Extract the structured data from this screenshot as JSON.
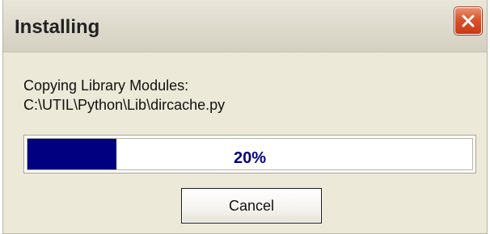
{
  "window": {
    "title": "Installing",
    "close_icon": "close-icon"
  },
  "status": {
    "line1": "Copying Library Modules:",
    "line2": "C:\\UTIL\\Python\\Lib\\dircache.py"
  },
  "progress": {
    "percent": 20,
    "label": "20%",
    "fill_color": "#000080"
  },
  "buttons": {
    "cancel": "Cancel"
  },
  "colors": {
    "window_bg": "#ece9d8",
    "close_button": "#d9532d"
  }
}
